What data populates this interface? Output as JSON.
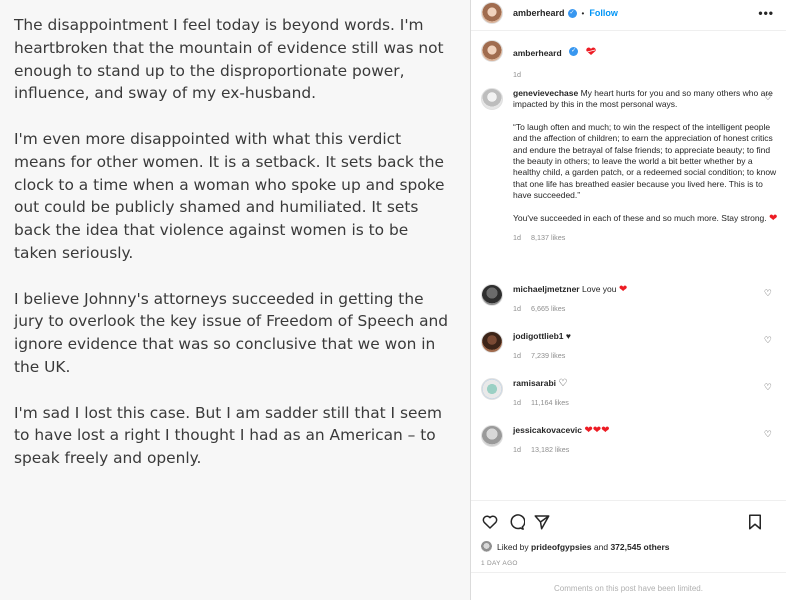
{
  "post_text": {
    "paragraphs": [
      "The disappointment I feel today is beyond words. I'm heartbroken that the mountain of evidence still was not enough to stand up to the disproportionate power, influence, and sway of my ex-husband.",
      "I'm even more disappointed with what this verdict means for other women. It is a setback. It sets back the clock to a time when a woman who spoke up and spoke out could be publicly shamed and humiliated. It sets back the idea that violence against women is to be taken seriously.",
      "I believe Johnny's attorneys succeeded in getting the jury to overlook the key issue of Freedom of Speech and ignore evidence that was so conclusive that we won in the UK.",
      "I'm sad I lost this case. But I am sadder still that I seem to have lost a right I thought I had as an American – to speak freely and openly."
    ]
  },
  "header": {
    "username": "amberheard",
    "separator": "•",
    "follow_label": "Follow",
    "more_label": "•••"
  },
  "caption": {
    "username": "amberheard",
    "emoji": "heart-with-ribbon",
    "time": "1d"
  },
  "comments": [
    {
      "username": "genevievechase",
      "text_lines": [
        "My heart hurts for you and so many others who are impacted by this in the most personal ways.",
        "“To laugh often and much; to win the respect of the intelligent people and the affection of children; to earn the appreciation of honest critics and endure the betrayal of false friends; to appreciate beauty; to find the beauty in others; to leave the world a bit better whether by a healthy child, a garden patch, or a redeemed social condition; to know that one life has breathed easier because you lived here. This is to have succeeded.”",
        "You've succeeded in each of these and so much more. Stay strong."
      ],
      "time": "1d",
      "likes": "8,137 likes"
    },
    {
      "username": "michaeljmetzner",
      "text": "Love you",
      "time": "1d",
      "likes": "6,665 likes"
    },
    {
      "username": "jodigottlieb1",
      "text": "♥",
      "time": "1d",
      "likes": "7,239 likes"
    },
    {
      "username": "ramisarabi",
      "text": "♡",
      "time": "1d",
      "likes": "11,164 likes"
    },
    {
      "username": "jessicakovacevic",
      "text": "",
      "time": "1d",
      "likes": "13,182 likes"
    }
  ],
  "likes_summary": {
    "prefix": "Liked by",
    "user": "prideofgypsies",
    "and": "and",
    "others": "372,545 others"
  },
  "post_time": "1 DAY AGO",
  "comments_limited": "Comments on this post have been limited.",
  "icons": {
    "like": "heart-outline-icon",
    "comment": "comment-bubble-icon",
    "share": "paper-plane-icon",
    "save": "bookmark-icon"
  },
  "colors": {
    "follow": "#0095f6",
    "verified": "#3897f0",
    "heart": "#ed1c24",
    "muted": "#8e8e8e"
  }
}
